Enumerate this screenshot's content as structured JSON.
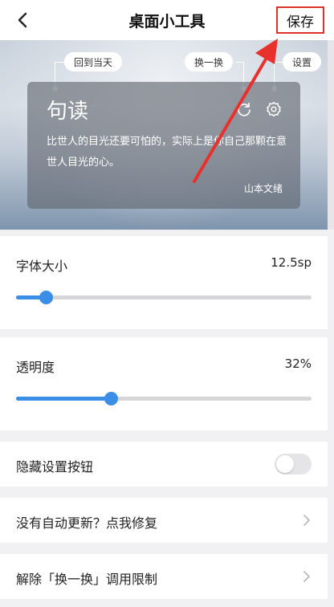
{
  "header": {
    "title": "桌面小工具",
    "save_label": "保存"
  },
  "preview": {
    "tips": {
      "today": "回到当天",
      "change": "换一换",
      "settings": "设置"
    },
    "card": {
      "title": "句读",
      "quote": "比世人的目光还要可怕的，实际上是你自己那颗在意世人目光的心。",
      "author": "山本文绪"
    }
  },
  "settings": {
    "font_size": {
      "label": "字体大小",
      "value": "12.5sp",
      "level": 0.1
    },
    "opacity": {
      "label": "透明度",
      "value": "32%",
      "level": 0.32
    },
    "hide_button": {
      "label": "隐藏设置按钮",
      "enabled": false
    },
    "fix_update": {
      "label": "没有自动更新？点我修复"
    },
    "unlock_change": {
      "label": "解除「换一换」调用限制"
    }
  },
  "colors": {
    "accent": "#3a8ee6",
    "highlight": "#e0302c"
  }
}
